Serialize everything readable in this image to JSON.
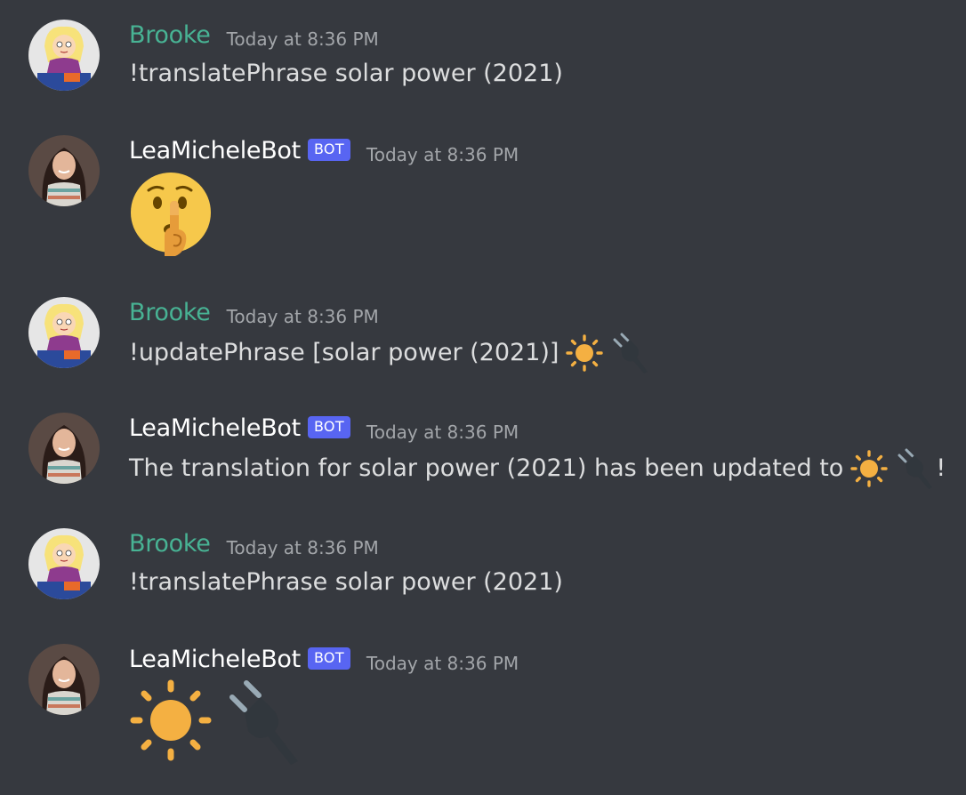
{
  "messages": [
    {
      "author": "Brooke",
      "is_bot": false,
      "timestamp": "Today at 8:36 PM",
      "text": "!translatePhrase solar power (2021)",
      "emojis": []
    },
    {
      "author": "LeaMicheleBot",
      "is_bot": true,
      "bot_tag": "BOT",
      "timestamp": "Today at 8:36 PM",
      "text": "",
      "emojis": [
        "shushing-face-emoji"
      ]
    },
    {
      "author": "Brooke",
      "is_bot": false,
      "timestamp": "Today at 8:36 PM",
      "text": "!updatePhrase [solar power (2021)]",
      "emojis": [
        "sun-emoji",
        "electric-plug-emoji"
      ]
    },
    {
      "author": "LeaMicheleBot",
      "is_bot": true,
      "bot_tag": "BOT",
      "timestamp": "Today at 8:36 PM",
      "text": "The translation for solar power (2021) has been updated to",
      "text_after": "!",
      "emojis": [
        "sun-emoji",
        "electric-plug-emoji"
      ]
    },
    {
      "author": "Brooke",
      "is_bot": false,
      "timestamp": "Today at 8:36 PM",
      "text": "!translatePhrase solar power (2021)",
      "emojis": []
    },
    {
      "author": "LeaMicheleBot",
      "is_bot": true,
      "bot_tag": "BOT",
      "timestamp": "Today at 8:36 PM",
      "text": "",
      "emojis": [
        "sun-emoji",
        "electric-plug-emoji"
      ]
    }
  ],
  "colors": {
    "background": "#36393f",
    "brooke_name": "#48b394",
    "bot_name": "#ffffff",
    "bot_tag_bg": "#5865f2",
    "timestamp": "#a3a6aa",
    "message_text": "#dcddde"
  }
}
